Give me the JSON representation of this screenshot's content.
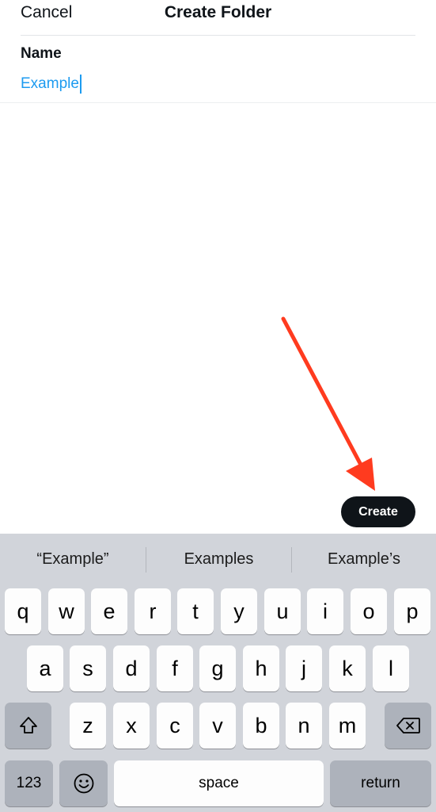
{
  "header": {
    "cancel_label": "Cancel",
    "title": "Create Folder"
  },
  "form": {
    "name_label": "Name",
    "name_value": "Example"
  },
  "actions": {
    "create_label": "Create"
  },
  "keyboard": {
    "suggestions": [
      "“Example”",
      "Examples",
      "Example’s"
    ],
    "row1": [
      "q",
      "w",
      "e",
      "r",
      "t",
      "y",
      "u",
      "i",
      "o",
      "p"
    ],
    "row2": [
      "a",
      "s",
      "d",
      "f",
      "g",
      "h",
      "j",
      "k",
      "l"
    ],
    "row3": [
      "z",
      "x",
      "c",
      "v",
      "b",
      "n",
      "m"
    ],
    "numbers_label": "123",
    "space_label": "space",
    "return_label": "return",
    "icons": {
      "shift": "shift-icon",
      "backspace": "backspace-icon",
      "emoji": "emoji-icon"
    }
  },
  "colors": {
    "accent": "#1d9bf0",
    "button_dark": "#0f1419",
    "annotation_arrow": "#ff3b1f",
    "keyboard_bg": "#d1d4da"
  }
}
